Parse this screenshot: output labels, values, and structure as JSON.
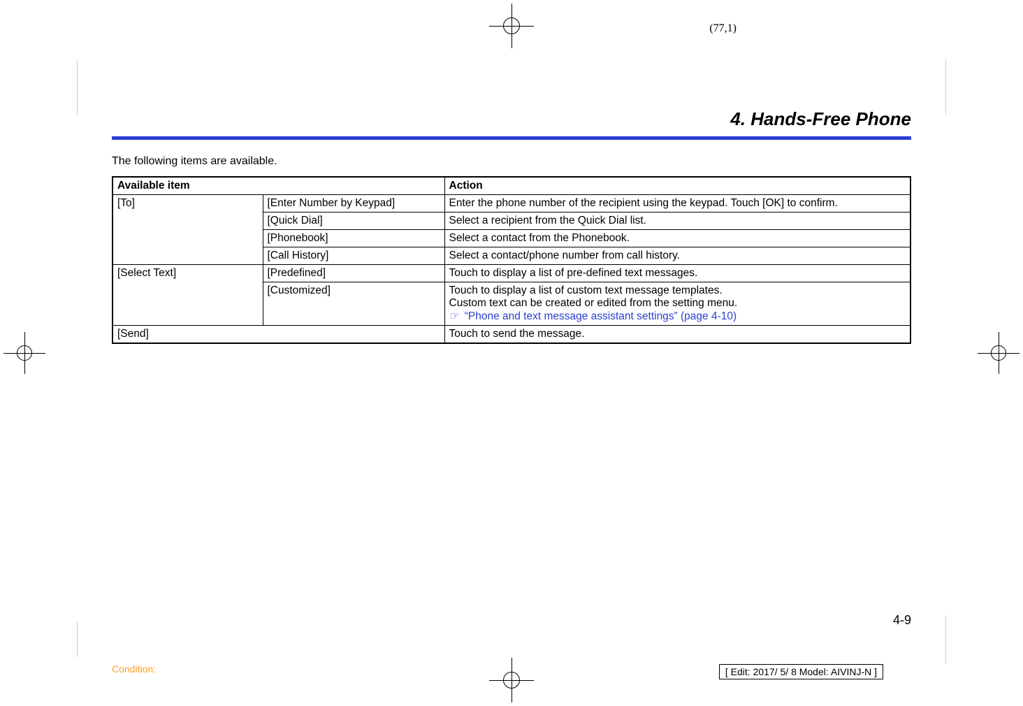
{
  "coord": "(77,1)",
  "section_title": "4. Hands-Free Phone",
  "intro": "The following items are available.",
  "table": {
    "head": {
      "c1": "Available item",
      "c2": "Action"
    },
    "rows": {
      "to_label": "[To]",
      "to_sub": {
        "r1": {
          "item": "[Enter Number by Keypad]",
          "action": "Enter the phone number of the recipient using the keypad. Touch [OK] to confirm."
        },
        "r2": {
          "item": "[Quick Dial]",
          "action": "Select a recipient from the Quick Dial list."
        },
        "r3": {
          "item": "[Phonebook]",
          "action": "Select a contact from the Phonebook."
        },
        "r4": {
          "item": "[Call History]",
          "action": "Select a contact/phone number from call history."
        }
      },
      "select_text_label": "[Select Text]",
      "select_sub": {
        "r1": {
          "item": "[Predefined]",
          "action": "Touch to display a list of pre-defined text messages."
        },
        "r2": {
          "item": "[Customized]",
          "action_line1": "Touch to display a list of custom text message templates.",
          "action_line2": "Custom text can be created or edited from the setting menu.",
          "action_link": "“Phone and text message assistant settings” (page 4-10)"
        }
      },
      "send": {
        "item": "[Send]",
        "action": "Touch to send the message."
      }
    }
  },
  "page_num": "4-9",
  "condition": "Condition:",
  "edit_line": "[ Edit: 2017/ 5/ 8   Model: AIVINJ-N ]"
}
